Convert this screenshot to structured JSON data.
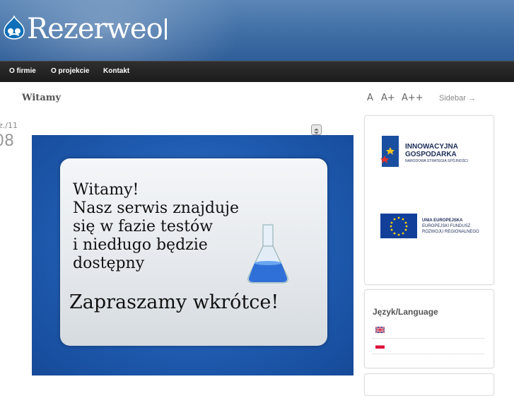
{
  "header": {
    "site_name": "Rezerweo"
  },
  "nav": {
    "items": [
      "O firmie",
      "O projekcie",
      "Kontakt"
    ]
  },
  "page": {
    "title": "Witamy"
  },
  "font_size_controls": [
    "A",
    "A+",
    "A++"
  ],
  "sidebar_toggle": "Sidebar →",
  "date": {
    "month": "z./11",
    "day": "08"
  },
  "banner": {
    "message": "Witamy!\nNasz serwis znajduje\nsię w fazie testów\ni niedługo będzie\ndostępny",
    "cta": "Zapraszamy wkrótce!"
  },
  "logos": {
    "ig_title_1": "INNOWACYJNA",
    "ig_title_2": "GOSPODARKA",
    "ig_subtitle": "NARODOWA STRATEGIA SPÓJNOŚCI",
    "eu_line_1": "UNIA EUROPEJSKA",
    "eu_line_2": "EUROPEJSKI FUNDUSZ",
    "eu_line_3": "ROZWOJU REGIONALNEGO"
  },
  "language_block": {
    "title": "Język/Language",
    "languages": [
      "English",
      "Polski"
    ]
  },
  "colors": {
    "header_blue": "#3f6ea5",
    "nav_dark": "#1b1b1b",
    "banner_blue": "#1f5bb0"
  }
}
